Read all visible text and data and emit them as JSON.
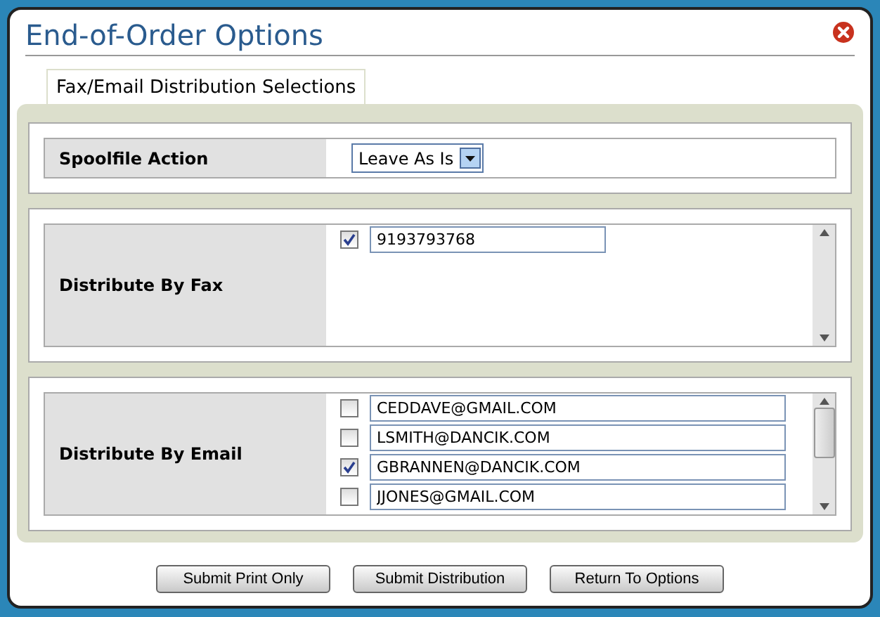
{
  "window": {
    "title": "End-of-Order Options"
  },
  "tab": {
    "label": "Fax/Email Distribution Selections"
  },
  "spoolfile": {
    "label": "Spoolfile Action",
    "value": "Leave As Is"
  },
  "fax": {
    "label": "Distribute By Fax",
    "entries": [
      {
        "value": "9193793768",
        "checked": true
      }
    ]
  },
  "email": {
    "label": "Distribute By Email",
    "entries": [
      {
        "value": "CEDDAVE@GMAIL.COM",
        "checked": false
      },
      {
        "value": "LSMITH@DANCIK.COM",
        "checked": false
      },
      {
        "value": "GBRANNEN@DANCIK.COM",
        "checked": true
      },
      {
        "value": "JJONES@GMAIL.COM",
        "checked": false
      }
    ]
  },
  "buttons": [
    "Submit Print Only",
    "Submit Distribution",
    "Return To Options"
  ]
}
